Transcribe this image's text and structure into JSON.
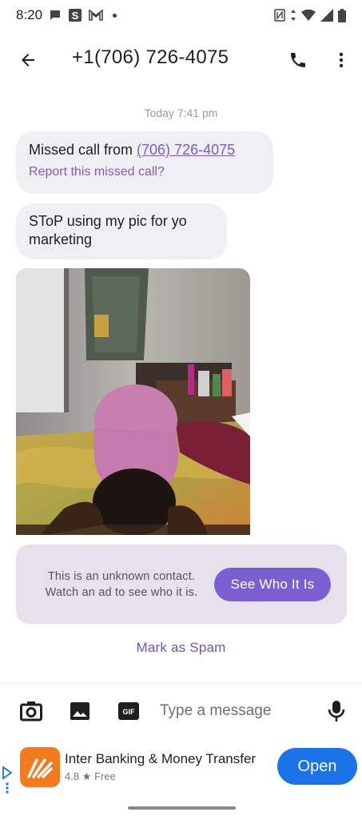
{
  "status_bar": {
    "time": "8:20",
    "icons": [
      "chat-bubble-icon",
      "s-app-icon",
      "gmail-icon",
      "dot-icon",
      "nfc-icon",
      "data-arrows-icon",
      "wifi-icon",
      "signal-icon",
      "battery-icon"
    ]
  },
  "header": {
    "title": "+1(706) 726-4075",
    "icons": [
      "back-arrow-icon",
      "phone-icon",
      "more-vert-icon"
    ]
  },
  "conversation": {
    "timestamp": "Today 7:41 pm",
    "messages": [
      {
        "type": "missed_call",
        "prefix": "Missed call from ",
        "number": "(706) 726-4075",
        "action": "Report this missed call?"
      },
      {
        "type": "text",
        "text": "SToP using my pic for yo marketing"
      },
      {
        "type": "image"
      }
    ]
  },
  "unknown_contact": {
    "text": "This is an unknown contact. Watch an ad to see who it is.",
    "button": "See Who It Is"
  },
  "spam": {
    "label": "Mark as Spam"
  },
  "compose": {
    "placeholder": "Type a message",
    "icons": [
      "camera-icon",
      "gallery-icon",
      "gif-icon",
      "mic-icon"
    ],
    "gif_label": "GIF"
  },
  "ad": {
    "title": "Inter Banking & Money Transfer",
    "rating": "4.8",
    "price": "Free",
    "button": "Open"
  },
  "colors": {
    "accent": "#7a5fd0",
    "link": "#7b5cc7",
    "bubble": "#f0f0f3",
    "card": "#e7e1ec",
    "ad_button": "#1a73e8",
    "ad_logo": "#f47a20"
  }
}
